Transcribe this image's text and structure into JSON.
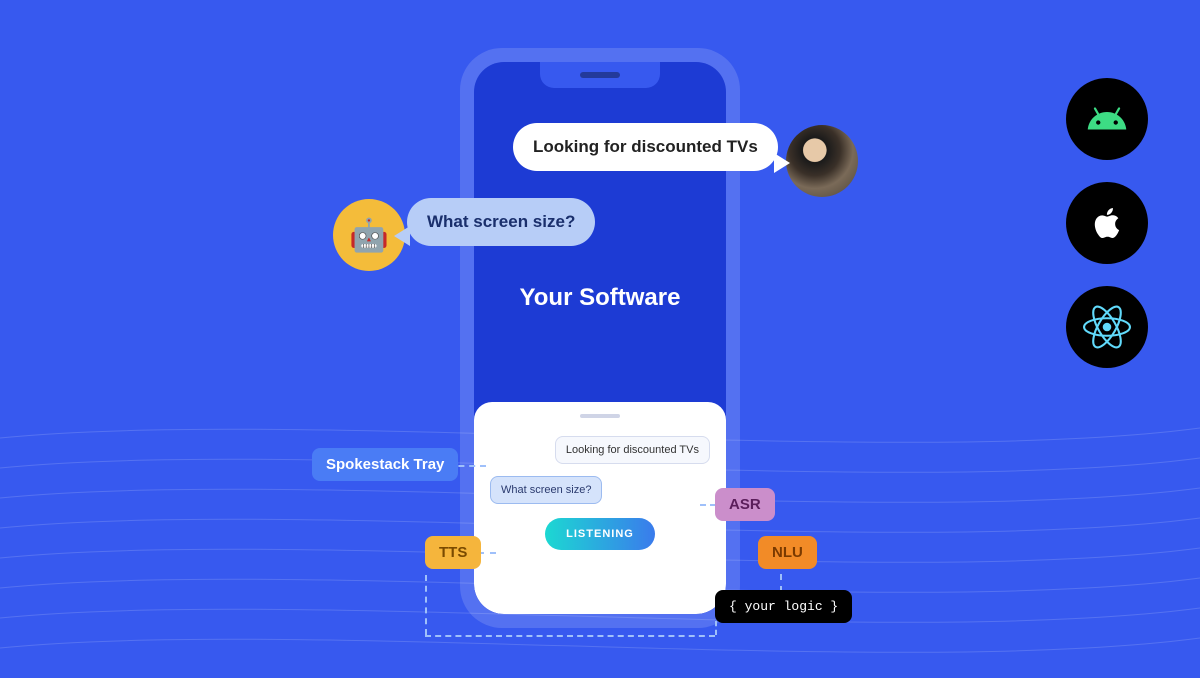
{
  "phoneTitle": "Your Software",
  "bubbles": {
    "user": "Looking for discounted TVs",
    "bot": "What screen size?"
  },
  "bot_emoji": "🤖",
  "tray": {
    "userMsg": "Looking for discounted TVs",
    "botMsg": "What screen size?",
    "listening": "LISTENING"
  },
  "labels": {
    "tray": "Spokestack Tray",
    "asr": "ASR",
    "tts": "TTS",
    "nlu": "NLU",
    "logic": "{ your logic }"
  }
}
